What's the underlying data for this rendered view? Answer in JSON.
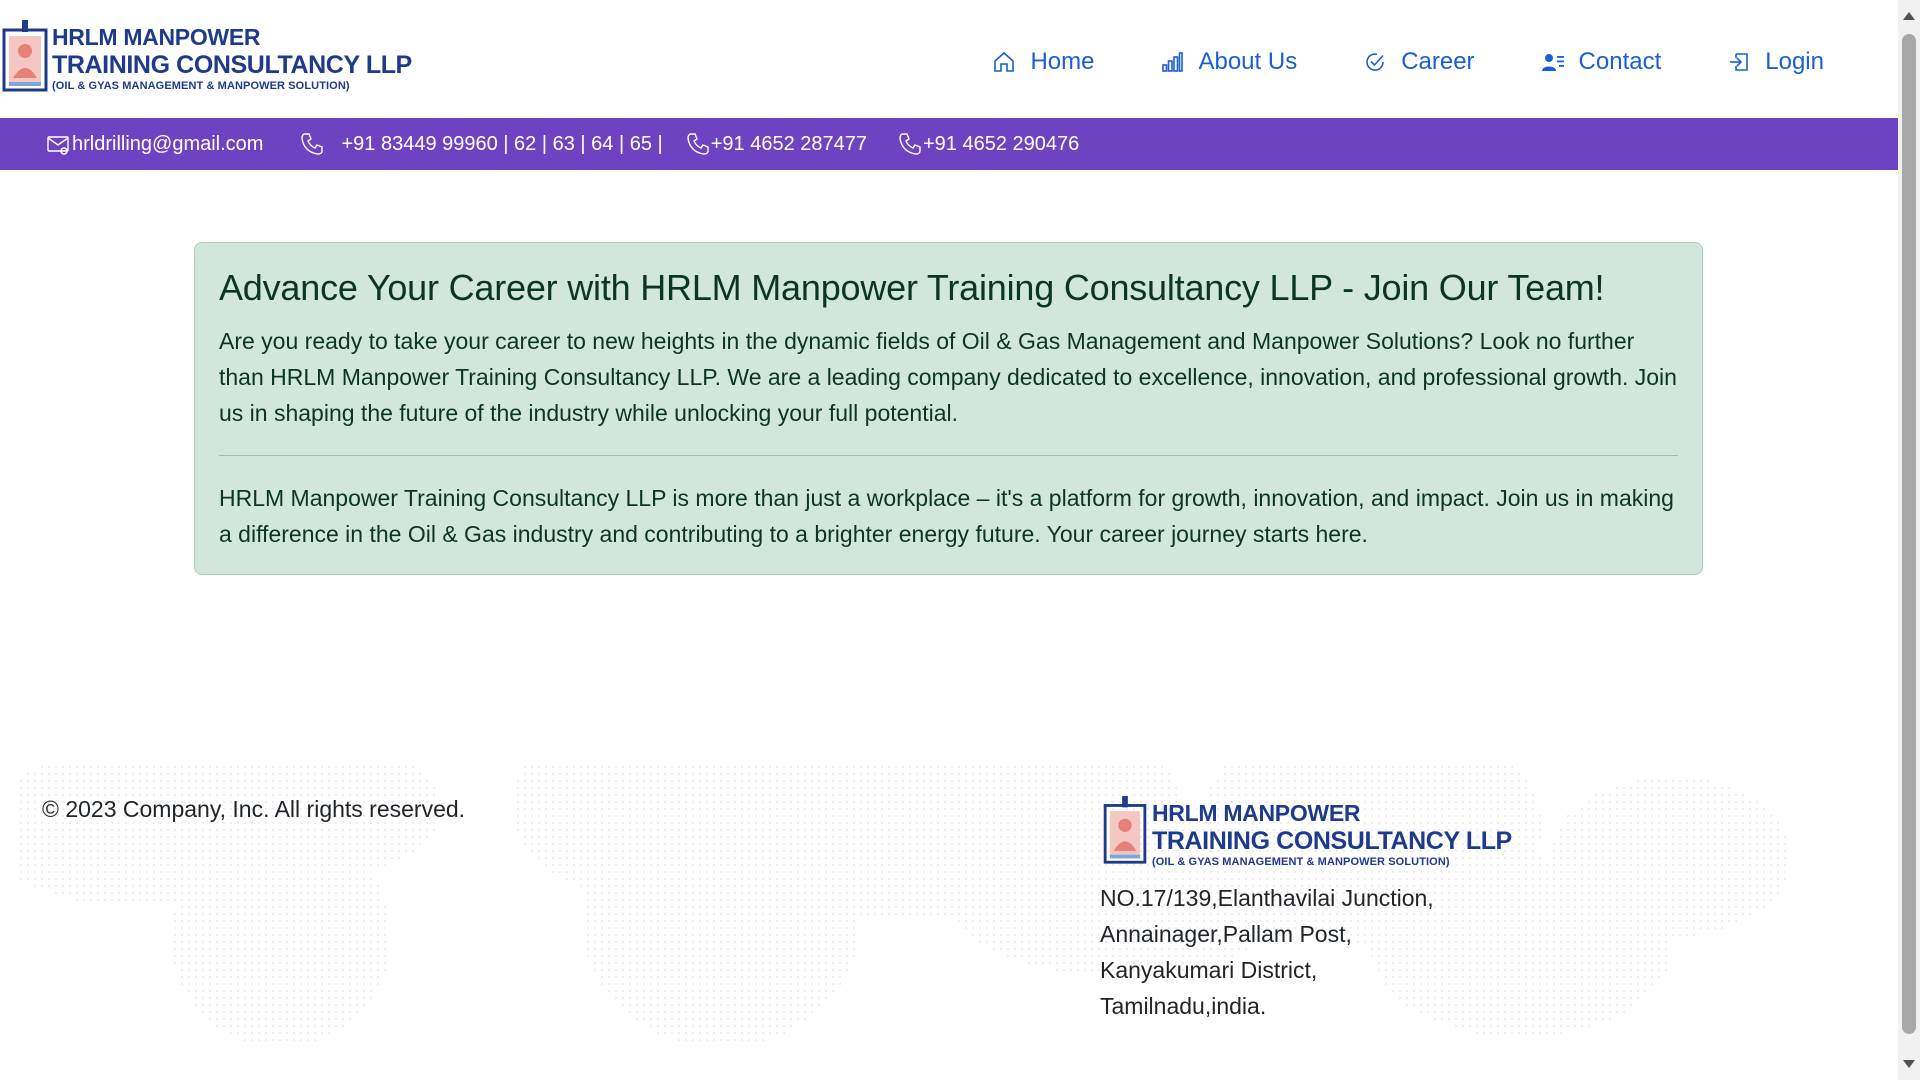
{
  "header": {
    "logo": {
      "line1": "HRLM MANPOWER",
      "line2": "TRAINING CONSULTANCY LLP",
      "line3": "(OIL & GYAS MANAGEMENT & MANPOWER SOLUTION)"
    },
    "nav": [
      {
        "label": "Home",
        "icon": "home-icon"
      },
      {
        "label": "About Us",
        "icon": "bar-chart-icon"
      },
      {
        "label": "Career",
        "icon": "check-circle-icon"
      },
      {
        "label": "Contact",
        "icon": "person-lines-icon"
      },
      {
        "label": "Login",
        "icon": "login-icon"
      }
    ]
  },
  "contact_bar": {
    "email": "hrldrilling@gmail.com",
    "phone1": "+91 83449 99960 | 62 | 63 | 64 | 65 |",
    "phone2": "+91 4652 287477",
    "phone3": "+91 4652 290476",
    "background": "#6f42c1"
  },
  "main": {
    "heading": "Advance Your Career with HRLM Manpower Training Consultancy LLP - Join Our Team!",
    "paragraph1": "Are you ready to take your career to new heights in the dynamic fields of Oil & Gas Management and Manpower Solutions? Look no further than HRLM Manpower Training Consultancy LLP. We are a leading company dedicated to excellence, innovation, and professional growth. Join us in shaping the future of the industry while unlocking your full potential.",
    "paragraph2": "HRLM Manpower Training Consultancy LLP is more than just a workplace – it's a platform for growth, innovation, and impact. Join us in making a difference in the Oil & Gas industry and contributing to a brighter energy future. Your career journey starts here.",
    "background": "#d1e7dd"
  },
  "footer": {
    "copyright": "© 2023 Company, Inc. All rights reserved.",
    "logo": {
      "line1": "HRLM MANPOWER",
      "line2": "TRAINING CONSULTANCY LLP",
      "line3": "(OIL & GYAS MANAGEMENT & MANPOWER SOLUTION)"
    },
    "address": [
      "NO.17/139,Elanthavilai Junction,",
      "Annainager,Pallam Post,",
      "Kanyakumari District,",
      "Tamilnadu,india."
    ]
  },
  "colors": {
    "brand_blue": "#1e3a8a",
    "nav_blue": "#1a5fd4",
    "purple": "#6f42c1"
  }
}
